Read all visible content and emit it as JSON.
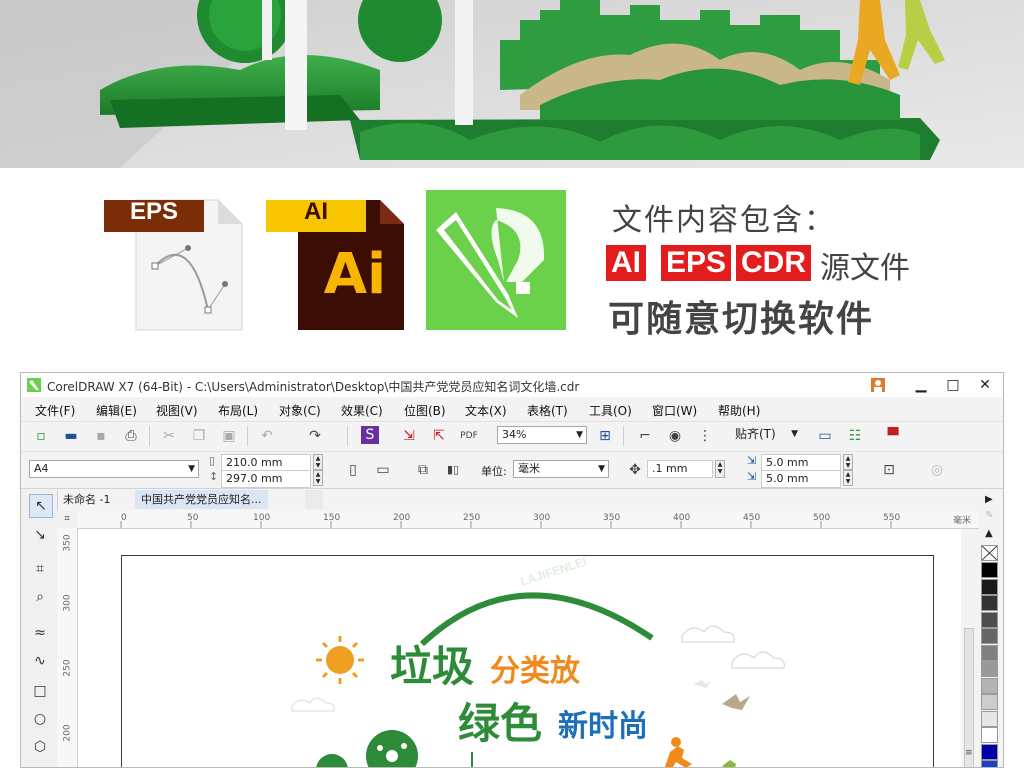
{
  "promo": {
    "eps_tag": "EPS",
    "ai_tag": "AI",
    "ai_letters": "Ai",
    "title": "文件内容包含：",
    "badges": [
      "AI",
      "EPS",
      "CDR"
    ],
    "source_suffix": "源文件",
    "switch_text": "可随意切换软件"
  },
  "window": {
    "title": "CorelDRAW X7 (64-Bit) - C:\\Users\\Administrator\\Desktop\\中国共产党党员应知名词文化墙.cdr",
    "controls": [
      "▁",
      "□",
      "✕"
    ]
  },
  "menu": [
    "文件(F)",
    "编辑(E)",
    "视图(V)",
    "布局(L)",
    "对象(C)",
    "效果(C)",
    "位图(B)",
    "文本(X)",
    "表格(T)",
    "工具(O)",
    "窗口(W)",
    "帮助(H)"
  ],
  "toolbar": {
    "zoom": "34%",
    "snap_label": "贴齐(T)"
  },
  "propbar": {
    "page_size": "A4",
    "width": "210.0 mm",
    "height": "297.0 mm",
    "units_label": "单位:",
    "units": "毫米",
    "nudge": ".1 mm",
    "dup_x": "5.0 mm",
    "dup_y": "5.0 mm"
  },
  "tabs": [
    "未命名 -1",
    "中国共产党党员应知名..."
  ],
  "ruler": {
    "h_ticks": [
      "0",
      "50",
      "100",
      "150",
      "200",
      "250",
      "300",
      "350",
      "400",
      "450",
      "500",
      "550"
    ],
    "unit": "毫米",
    "v_ticks": [
      "350",
      "300",
      "250",
      "200"
    ]
  },
  "poster": {
    "arc_text": "LAJIFENLEI",
    "line1_main": "垃圾",
    "line1_sub": "分类放",
    "line2_main": "绿色",
    "line2_sub": "新时尚"
  },
  "colors": {
    "brand_red": "#e31d1d",
    "cdr_green": "#6cd14a",
    "poster_green": "#2e8b3a",
    "poster_orange": "#f08a1c",
    "poster_blue": "#1d6fb8"
  },
  "palette": [
    "#000000",
    "#1a1a1a",
    "#333333",
    "#4d4d4d",
    "#666666",
    "#808080",
    "#999999",
    "#b3b3b3",
    "#cccccc",
    "#e6e6e6",
    "#ffffff",
    "#0000aa",
    "#1d3fc8"
  ]
}
